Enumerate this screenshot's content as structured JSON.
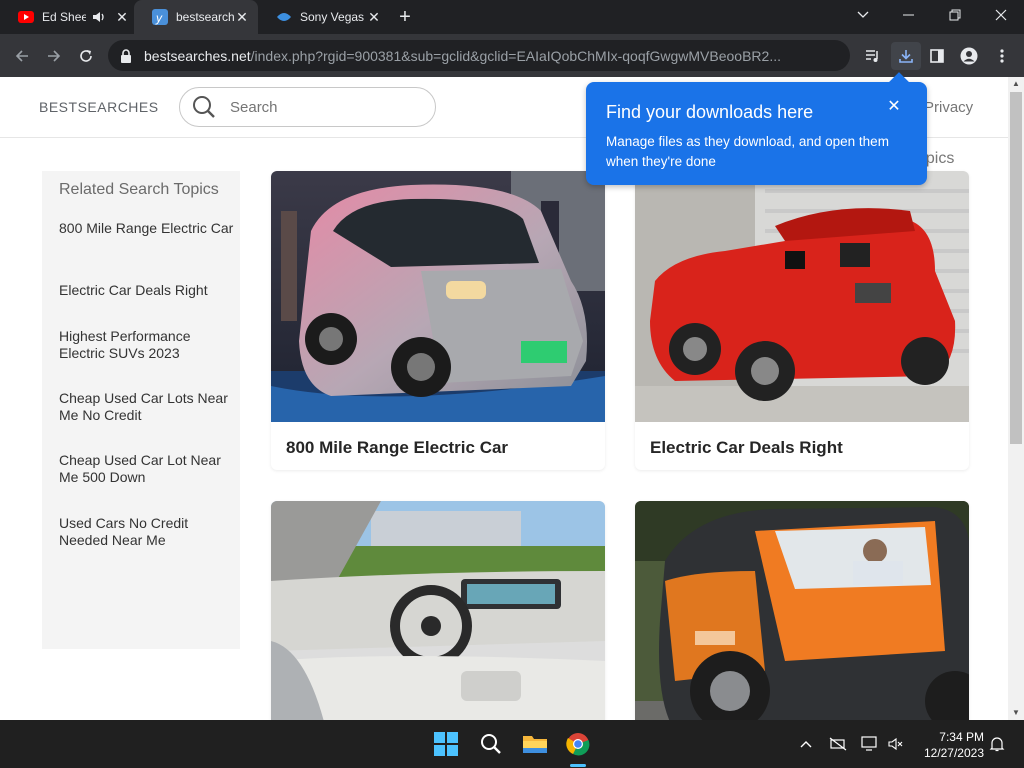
{
  "browser": {
    "tabs": [
      {
        "title": "Ed Sheeran",
        "favicon": "youtube-icon",
        "audio": true
      },
      {
        "title": "bestsearches",
        "favicon": "bestsearches-favicon",
        "active": true
      },
      {
        "title": "Sony Vegas",
        "favicon": "sony-vegas-favicon"
      }
    ],
    "url_host": "bestsearches.net",
    "url_path": "/index.php?rgid=900381&sub=gclid&gclid=EAIaIQobChMIx-qoqfGwgwMVBeooBR2...",
    "download_bubble": {
      "title": "Find your downloads here",
      "body": "Manage files as they download, and open them when they're done"
    }
  },
  "site": {
    "brand": "BESTSEARCHES",
    "search_placeholder": "Search",
    "nav_privacy": "Privacy",
    "topics_heading_partial": "opics",
    "sidebar": {
      "heading": "Related Search Topics",
      "links": [
        "800 Mile Range Electric Car",
        "Electric Car Deals Right",
        "Highest Performance Electric SUVs 2023",
        "Cheap Used Car Lots Near Me No Credit",
        "Cheap Used Car Lot Near Me 500 Down",
        "Used Cars No Credit Needed Near Me"
      ]
    },
    "cards": [
      {
        "caption": "800 Mile Range Electric Car",
        "image": "silver-pink-microcar-photo"
      },
      {
        "caption": "Electric Car Deals Right",
        "image": "red-roadster-microcar-photo"
      },
      {
        "caption": "",
        "image": "ev-interior-dashboard-photo"
      },
      {
        "caption": "",
        "image": "orange-citroen-ami-photo"
      }
    ]
  },
  "taskbar": {
    "time": "7:34 PM",
    "date": "12/27/2023"
  },
  "colors": {
    "accent": "#1a73e8",
    "chrome_dark": "#202124",
    "chrome_toolbar": "#35363a",
    "taskbar": "#202020"
  }
}
